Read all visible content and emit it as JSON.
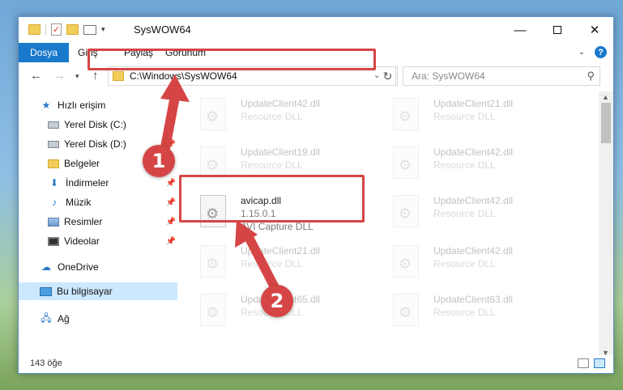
{
  "window": {
    "title": "SysWOW64",
    "minimize": "—",
    "close": "✕"
  },
  "ribbon": {
    "tabs": [
      "Dosya",
      "Giriş",
      "Paylaş",
      "Görünüm"
    ],
    "help": "?"
  },
  "navigation": {
    "address": "C:\\Windows\\SysWOW64",
    "search_placeholder": "Ara: SysWOW64"
  },
  "sidebar": {
    "items": [
      {
        "label": "Hızlı erişim",
        "icon": "star-icon"
      },
      {
        "label": "Yerel Disk (C:)",
        "icon": "drive-icon",
        "pinned": true
      },
      {
        "label": "Yerel Disk (D:)",
        "icon": "drive-icon",
        "pinned": true
      },
      {
        "label": "Belgeler",
        "icon": "folder-icon",
        "pinned": true
      },
      {
        "label": "İndirmeler",
        "icon": "download-icon",
        "pinned": true
      },
      {
        "label": "Müzik",
        "icon": "music-icon",
        "pinned": true
      },
      {
        "label": "Resimler",
        "icon": "pictures-icon",
        "pinned": true
      },
      {
        "label": "Videolar",
        "icon": "video-icon",
        "pinned": true
      },
      {
        "label": "OneDrive",
        "icon": "cloud-icon"
      },
      {
        "label": "Bu bilgisayar",
        "icon": "computer-icon",
        "selected": true
      },
      {
        "label": "Ağ",
        "icon": "network-icon"
      }
    ]
  },
  "files": {
    "highlighted": {
      "name": "avicap.dll",
      "version": "1.15.0.1",
      "description": "AVI Capture DLL"
    },
    "left_column": [
      {
        "name": "UpdateClient42.dll",
        "description": "Resource DLL"
      },
      {
        "name": "UpdateClient19.dll",
        "description": "Resource DLL"
      },
      {
        "name": "UpdateClient21.dll",
        "description": "Resource DLL"
      },
      {
        "name": "UpdateClient65.dll",
        "description": "Resource DLL"
      }
    ],
    "right_column": [
      {
        "name": "UpdateClient21.dll",
        "description": "Resource DLL"
      },
      {
        "name": "UpdateClient42.dll",
        "description": "Resource DLL"
      },
      {
        "name": "UpdateClient42.dll",
        "description": "Resource DLL"
      },
      {
        "name": "UpdateClient42.dll",
        "description": "Resource DLL"
      },
      {
        "name": "UpdateClient63.dll",
        "description": "Resource DLL"
      }
    ]
  },
  "status": {
    "count": "143 öğe"
  },
  "annotations": {
    "badge_1": "1",
    "badge_2": "2",
    "color": "#d64545"
  }
}
